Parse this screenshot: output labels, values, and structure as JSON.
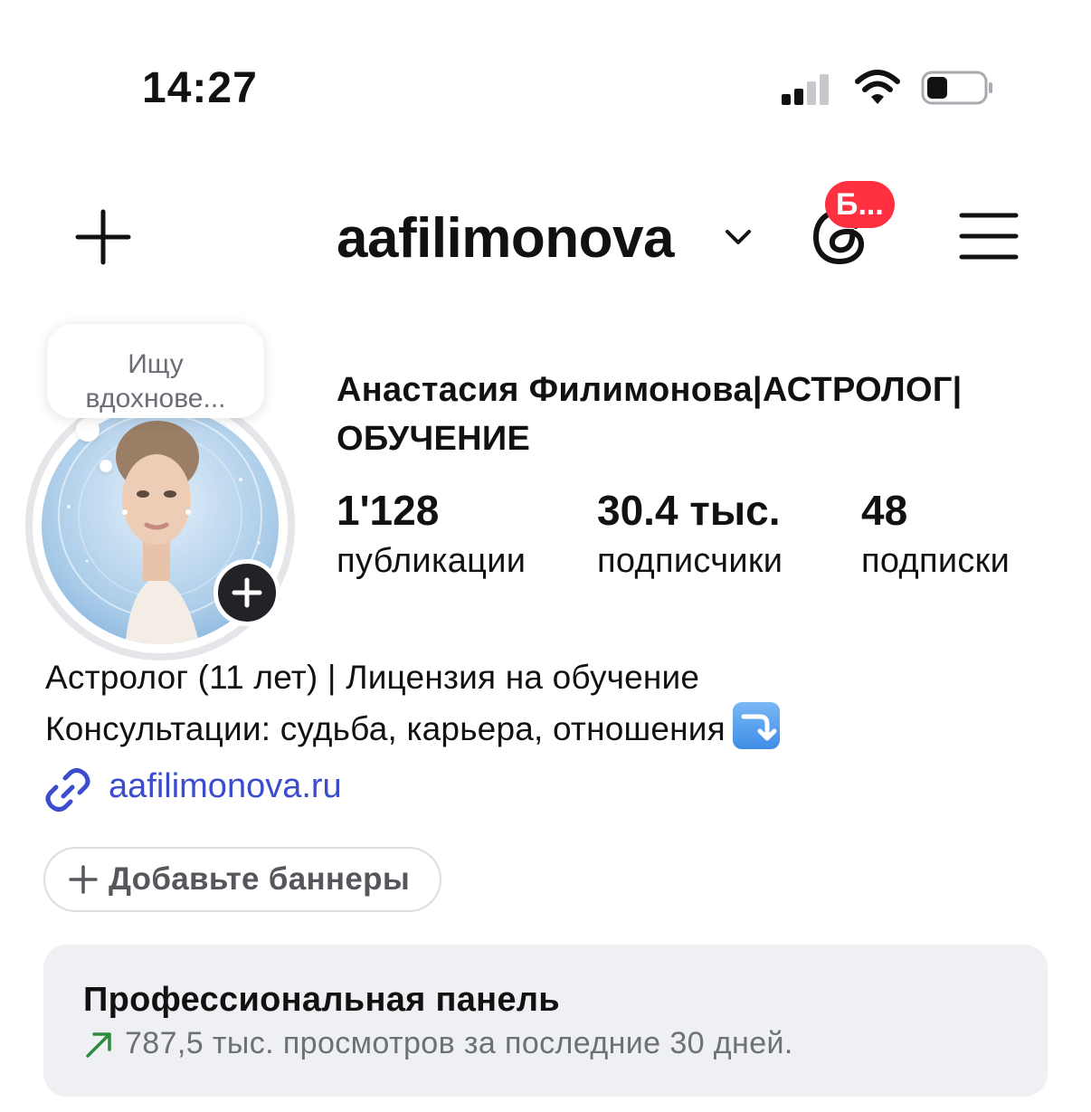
{
  "status_bar": {
    "time": "14:27",
    "icons": [
      "cellular-signal-icon",
      "wifi-icon",
      "battery-icon"
    ]
  },
  "header": {
    "username": "aafilimonova",
    "threads_badge": "Б...",
    "icons": [
      "plus-icon",
      "chevron-down-icon",
      "threads-icon",
      "menu-icon"
    ]
  },
  "profile": {
    "note": "Ищу вдохнове...",
    "full_name": "Анастасия Филимонова|АСТРОЛОГ| ОБУЧЕНИЕ",
    "stats": [
      {
        "value": "1'128",
        "label": "публикации"
      },
      {
        "value": "30.4 тыс.",
        "label": "подписчики"
      },
      {
        "value": "48",
        "label": "подписки"
      }
    ],
    "bio_lines": [
      "Астролог (11 лет) | Лицензия на обучение",
      "Консультации: судьба, карьера, отношения"
    ],
    "bio_emoji": "right-arrow-curving-down-emoji",
    "link": "aafilimonova.ru"
  },
  "banners_button": "Добавьте баннеры",
  "pro_panel": {
    "title": "Профессиональная панель",
    "subtitle": "787,5 тыс. просмотров за последние 30 дней."
  },
  "colors": {
    "badge": "#ff3040",
    "link": "#3b4ccd",
    "trend_arrow": "#2e8b3e",
    "panel_bg": "#eff0f3"
  }
}
